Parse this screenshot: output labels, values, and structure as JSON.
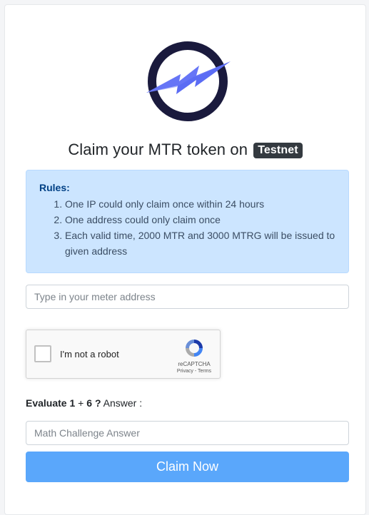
{
  "header": {
    "title_text": "Claim your MTR token on",
    "network_badge": "Testnet"
  },
  "rules": {
    "title": "Rules:",
    "items": [
      "One IP could only claim once within 24 hours",
      "One address could only claim once",
      "Each valid time, 2000 MTR and 3000 MTRG will be issued to given address"
    ]
  },
  "address_input": {
    "placeholder": "Type in your meter address",
    "value": ""
  },
  "recaptcha": {
    "label": "I'm not a robot",
    "brand": "reCAPTCHA",
    "privacy_link": "Privacy",
    "separator": "-",
    "terms_link": "Terms",
    "checked": false
  },
  "challenge": {
    "prefix": "Evaluate",
    "operand_a": "1",
    "operator": "+",
    "operand_b": "6",
    "question_mark": "?",
    "answer_label": "Answer :"
  },
  "math_input": {
    "placeholder": "Math Challenge Answer",
    "value": ""
  },
  "submit": {
    "label": "Claim Now"
  },
  "colors": {
    "logo_ring": "#1a1a3d",
    "logo_bolt": "#5b6cf4",
    "badge_bg": "#343a40",
    "alert_bg": "#cce5ff",
    "alert_text": "#004085",
    "button_bg": "#5aa7fb"
  },
  "icons": {
    "logo": "meter-lightning-logo",
    "captcha": "recaptcha-logo"
  }
}
